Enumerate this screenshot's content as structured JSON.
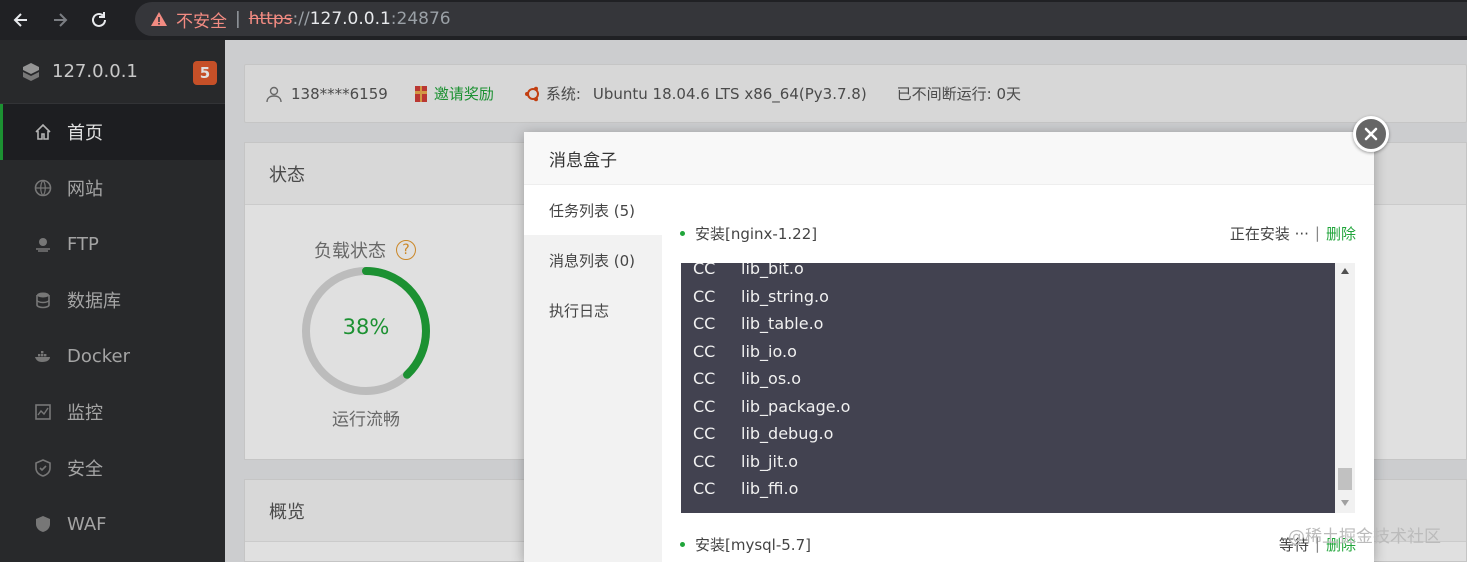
{
  "browser": {
    "security_label": "不安全",
    "separator": "|",
    "url_scheme": "https",
    "url_sep": "://",
    "url_host": "127.0.0.1",
    "url_port": ":24876"
  },
  "sidebar": {
    "host": "127.0.0.1",
    "badge": "5",
    "items": [
      {
        "label": "首页",
        "icon": "home-icon"
      },
      {
        "label": "网站",
        "icon": "globe-icon"
      },
      {
        "label": "FTP",
        "icon": "ftp-icon"
      },
      {
        "label": "数据库",
        "icon": "database-icon"
      },
      {
        "label": "Docker",
        "icon": "docker-icon"
      },
      {
        "label": "监控",
        "icon": "monitor-icon"
      },
      {
        "label": "安全",
        "icon": "shield-icon"
      },
      {
        "label": "WAF",
        "icon": "waf-shield-icon"
      }
    ]
  },
  "topinfo": {
    "user": "138****6159",
    "invite": "邀请奖励",
    "system_label": "系统:",
    "system_value": "Ubuntu 18.04.6 LTS x86_64(Py3.7.8)",
    "uptime": "已不间断运行: 0天"
  },
  "status": {
    "title": "状态",
    "load_title": "负载状态",
    "help": "?",
    "load_value": "38%",
    "load_fraction": 0.38,
    "load_status": "运行流畅"
  },
  "overview": {
    "title": "概览"
  },
  "modal": {
    "title": "消息盒子",
    "tabs": [
      "任务列表 (5)",
      "消息列表 (0)",
      "执行日志"
    ],
    "tasks": [
      {
        "name": "安装[nginx-1.22]",
        "state": "正在安装 ···",
        "delete": "删除"
      },
      {
        "name": "安装[mysql-5.7]",
        "state": "等待",
        "delete": "删除"
      }
    ],
    "pipe": "|",
    "log": [
      {
        "cmd": "CC",
        "file": "lib_bit.o"
      },
      {
        "cmd": "CC",
        "file": "lib_string.o"
      },
      {
        "cmd": "CC",
        "file": "lib_table.o"
      },
      {
        "cmd": "CC",
        "file": "lib_io.o"
      },
      {
        "cmd": "CC",
        "file": "lib_os.o"
      },
      {
        "cmd": "CC",
        "file": "lib_package.o"
      },
      {
        "cmd": "CC",
        "file": "lib_debug.o"
      },
      {
        "cmd": "CC",
        "file": "lib_jit.o"
      },
      {
        "cmd": "CC",
        "file": "lib_ffi.o"
      }
    ]
  },
  "watermark": "@稀土掘金技术社区",
  "colors": {
    "accent": "#20a53a",
    "badge": "#e25c2e",
    "sidebar": "#2e2f32",
    "console": "#424250"
  }
}
